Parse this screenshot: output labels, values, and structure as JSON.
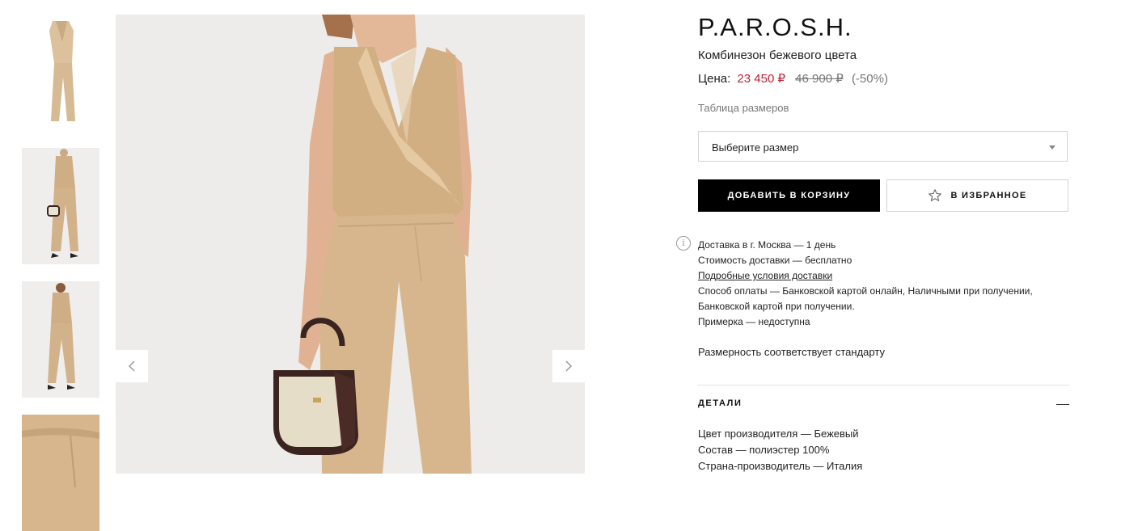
{
  "colors": {
    "accent_price": "#c21f32",
    "button_bg": "#000000",
    "beige": "#d7b68e"
  },
  "product": {
    "brand": "P.A.R.O.S.H.",
    "name": "Комбинезон бежевого цвета",
    "price_label": "Цена:",
    "price_now": "23 450 ₽",
    "price_old": "46 900 ₽",
    "discount": "(-50%)",
    "size_chart_link": "Таблица размеров",
    "size_select_placeholder": "Выберите размер",
    "add_to_cart": "ДОБАВИТЬ В КОРЗИНУ",
    "add_to_favorites": "В ИЗБРАННОЕ"
  },
  "delivery": {
    "line1": "Доставка в г. Москва — 1 день",
    "line2": "Стоимость доставки — бесплатно",
    "link": "Подробные условия доставки",
    "line3": "Способ оплаты — Банковской картой онлайн, Наличными при получении,",
    "line4": "Банковской картой при получении.",
    "line5": "Примерка — недоступна"
  },
  "size_note": "Размерность соответствует стандарту",
  "details": {
    "heading": "ДЕТАЛИ",
    "items": [
      "Цвет производителя — Бежевый",
      "Состав — полиэстер 100%",
      "Страна-производитель — Италия"
    ]
  },
  "gallery": {
    "prev_icon": "chevron-left-icon",
    "next_icon": "chevron-right-icon",
    "selected_thumbnail": 2
  }
}
